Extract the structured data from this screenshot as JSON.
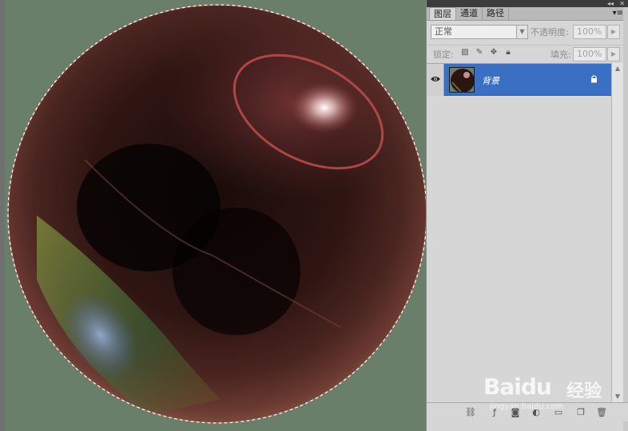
{
  "panel": {
    "tabs": [
      {
        "label": "图层",
        "active": true
      },
      {
        "label": "通道",
        "active": false
      },
      {
        "label": "路径",
        "active": false
      }
    ],
    "blend_mode": "正常",
    "opacity_label": "不透明度:",
    "opacity_value": "100%",
    "lock_label": "锁定:",
    "fill_label": "填充:",
    "fill_value": "100%",
    "layers": [
      {
        "name": "背景",
        "visible": true,
        "locked": true,
        "selected": true
      }
    ],
    "colors": {
      "selection": "#3a6fc4",
      "panel_bg": "#d6d6d6",
      "canvas_bg": "#6a7f69"
    }
  },
  "watermark": {
    "brand": "Bai",
    "brand2": "du",
    "brand_cn": "经验",
    "url": "jingyan.baidu.com"
  }
}
